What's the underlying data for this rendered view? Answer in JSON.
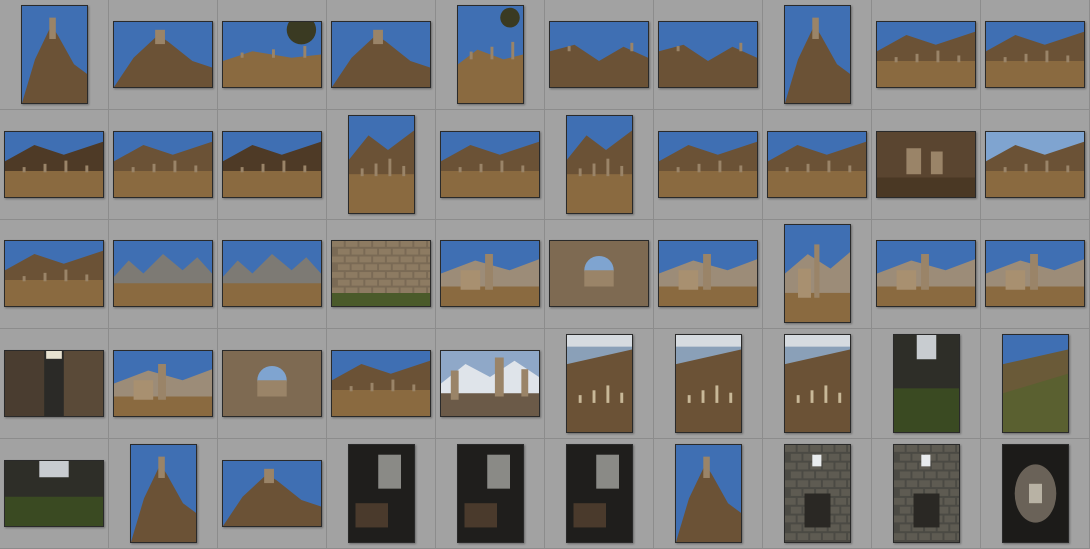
{
  "app": "photo-library-grid",
  "grid": {
    "columns": 10,
    "rows": 5
  },
  "colors": {
    "background": "#9b9b9b",
    "cell": "#a2a2a2",
    "cell_border": "#8c8c8c",
    "sky": "#3f6fb3",
    "sky_light": "#7fa4d0",
    "mountain": "#6b5236",
    "ground": "#8a6a40",
    "stone": "#9a8468",
    "dark_interior": "#2b2a27",
    "snow": "#dfe4ea",
    "foliage": "#4a5a2a"
  },
  "thumbnails": [
    {
      "scene": "tower-rock-sky",
      "orientation": "portrait"
    },
    {
      "scene": "tower-rock-sky",
      "orientation": "landscape"
    },
    {
      "scene": "towers-tree-sky",
      "orientation": "landscape"
    },
    {
      "scene": "tower-rock-sky",
      "orientation": "landscape"
    },
    {
      "scene": "towers-tree-sky",
      "orientation": "portrait"
    },
    {
      "scene": "towers-ridge-sky",
      "orientation": "landscape"
    },
    {
      "scene": "towers-ridge-sky",
      "orientation": "landscape"
    },
    {
      "scene": "tower-rock-sky",
      "orientation": "portrait"
    },
    {
      "scene": "valley-ruins",
      "orientation": "landscape"
    },
    {
      "scene": "valley-ruins",
      "orientation": "landscape"
    },
    {
      "scene": "valley-ruins-dark",
      "orientation": "landscape"
    },
    {
      "scene": "valley-ruins",
      "orientation": "landscape"
    },
    {
      "scene": "valley-ruins-dark",
      "orientation": "landscape"
    },
    {
      "scene": "valley-ruins",
      "orientation": "portrait"
    },
    {
      "scene": "valley-ruins",
      "orientation": "landscape"
    },
    {
      "scene": "valley-ruins",
      "orientation": "portrait"
    },
    {
      "scene": "valley-ruins",
      "orientation": "landscape"
    },
    {
      "scene": "valley-ruins",
      "orientation": "landscape"
    },
    {
      "scene": "ruins-close-dark",
      "orientation": "landscape"
    },
    {
      "scene": "ruins-cliffs",
      "orientation": "landscape"
    },
    {
      "scene": "valley-ruins",
      "orientation": "landscape"
    },
    {
      "scene": "peaks-valley",
      "orientation": "landscape"
    },
    {
      "scene": "peaks-valley",
      "orientation": "landscape"
    },
    {
      "scene": "stone-wall",
      "orientation": "landscape"
    },
    {
      "scene": "tower-ruins-peaks",
      "orientation": "landscape"
    },
    {
      "scene": "stone-arch",
      "orientation": "landscape"
    },
    {
      "scene": "tower-ruins-peaks",
      "orientation": "landscape"
    },
    {
      "scene": "tower-ruins-peaks",
      "orientation": "portrait"
    },
    {
      "scene": "tower-ruins-peaks",
      "orientation": "landscape"
    },
    {
      "scene": "tower-ruins-peaks",
      "orientation": "landscape"
    },
    {
      "scene": "dark-passage",
      "orientation": "landscape"
    },
    {
      "scene": "tower-ruins-peaks",
      "orientation": "landscape"
    },
    {
      "scene": "stone-arch",
      "orientation": "landscape"
    },
    {
      "scene": "valley-ruins",
      "orientation": "landscape"
    },
    {
      "scene": "snow-peaks-towers",
      "orientation": "landscape"
    },
    {
      "scene": "slope-ruins-cloudy",
      "orientation": "portrait"
    },
    {
      "scene": "slope-ruins-cloudy",
      "orientation": "portrait"
    },
    {
      "scene": "slope-ruins-cloudy",
      "orientation": "portrait"
    },
    {
      "scene": "dark-alley-green",
      "orientation": "portrait"
    },
    {
      "scene": "green-slope",
      "orientation": "portrait"
    },
    {
      "scene": "dark-alley-green",
      "orientation": "landscape"
    },
    {
      "scene": "tower-rock-sky",
      "orientation": "portrait"
    },
    {
      "scene": "tower-rock-sky",
      "orientation": "landscape"
    },
    {
      "scene": "dark-interior",
      "orientation": "portrait"
    },
    {
      "scene": "dark-interior",
      "orientation": "portrait"
    },
    {
      "scene": "dark-interior",
      "orientation": "portrait"
    },
    {
      "scene": "tower-rock-sky",
      "orientation": "portrait"
    },
    {
      "scene": "stone-window-dark",
      "orientation": "portrait"
    },
    {
      "scene": "stone-window-dark",
      "orientation": "portrait"
    },
    {
      "scene": "stone-tunnel",
      "orientation": "portrait"
    }
  ]
}
